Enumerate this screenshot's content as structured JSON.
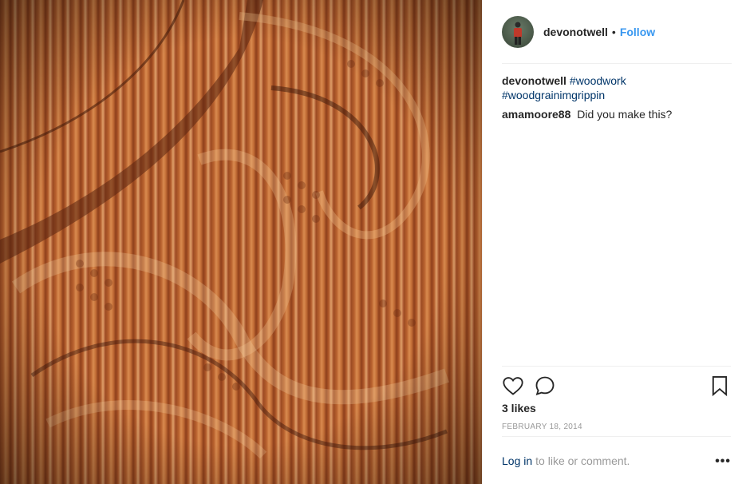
{
  "post": {
    "username": "devonotwell",
    "separator": "•",
    "follow_label": "Follow",
    "photo_icon": "woodcarving-photo"
  },
  "comments": [
    {
      "user": "devonotwell",
      "tags": [
        "#woodwork",
        "#woodgrainimgrippin"
      ]
    },
    {
      "user": "amamoore88",
      "text": "Did you make this?"
    }
  ],
  "actions": {
    "like_icon": "heart-icon",
    "comment_icon": "comment-icon",
    "save_icon": "bookmark-icon",
    "likes": "3 likes",
    "date": "FEBRUARY 18, 2014"
  },
  "footer": {
    "login_label": "Log in",
    "login_rest": "to like or comment.",
    "more_label": "•••"
  },
  "colors": {
    "link": "#3897f0",
    "hashtag": "#003569",
    "muted": "#999999"
  }
}
